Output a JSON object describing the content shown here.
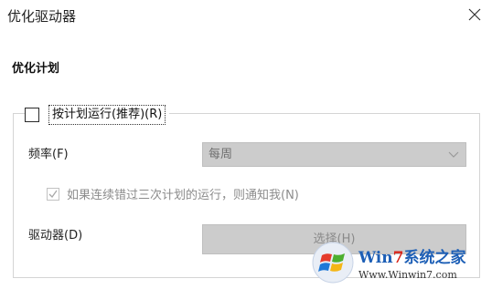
{
  "window": {
    "title": "优化驱动器"
  },
  "schedule": {
    "heading": "优化计划",
    "run_on_schedule_label": "按计划运行(推荐)(R)",
    "run_on_schedule_checked": false,
    "frequency_label": "频率(F)",
    "frequency_value": "每周",
    "notify_label": "如果连续错过三次计划的运行，则通知我(N)",
    "notify_checked": true,
    "drives_label": "驱动器(D)",
    "choose_button_label": "选择(H)"
  },
  "watermark": {
    "brand": "Win7系统之家",
    "url": "Www.Winwin7.com"
  }
}
